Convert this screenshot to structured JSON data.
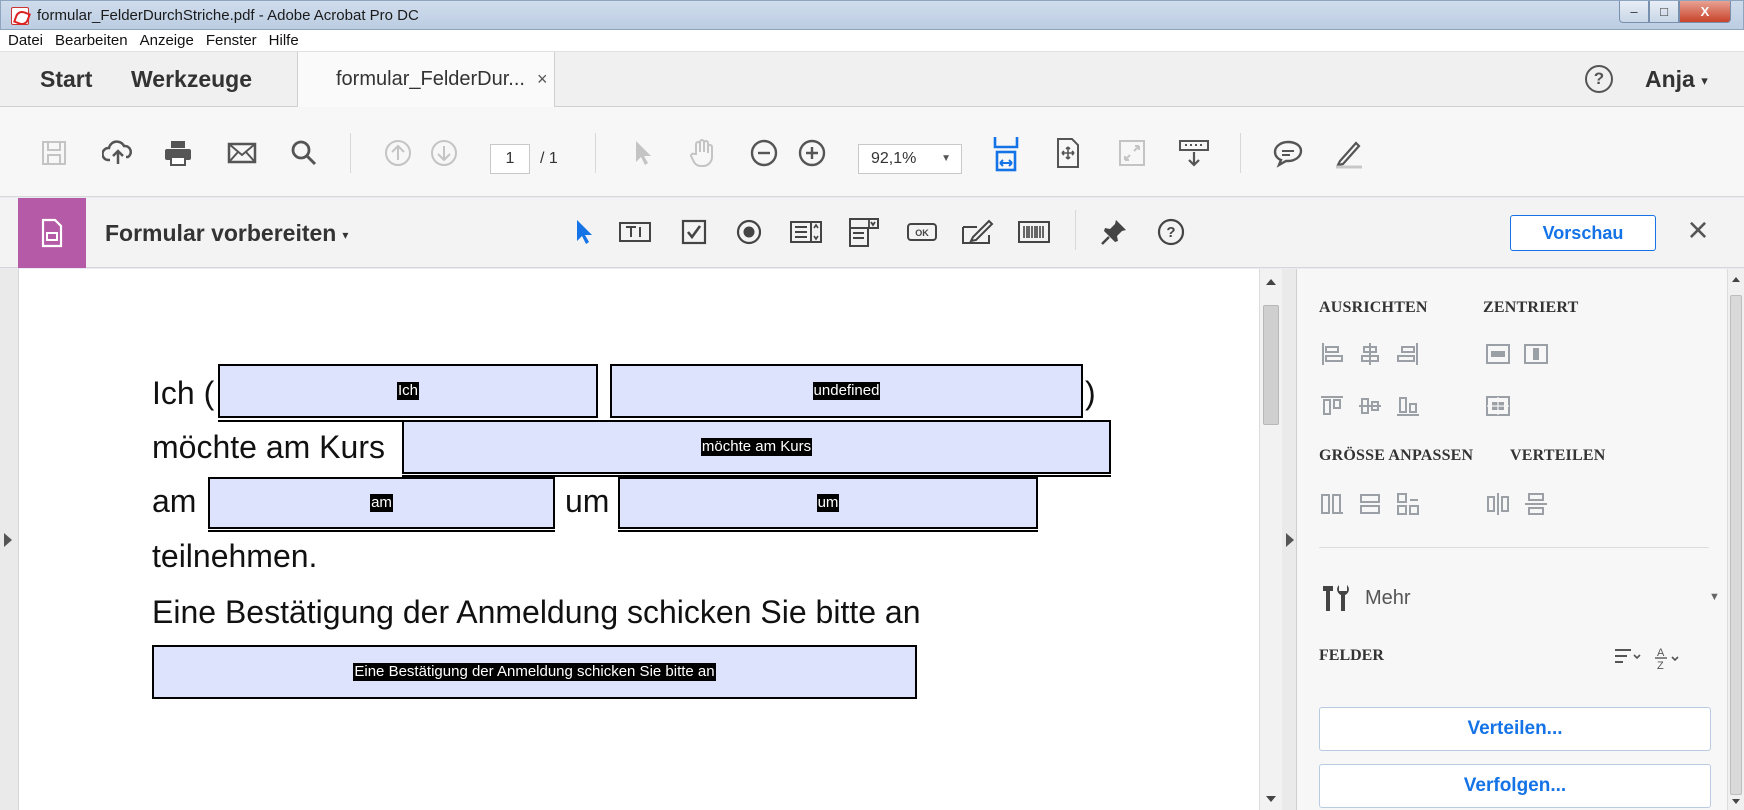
{
  "window": {
    "title": "formular_FelderDurchStriche.pdf - Adobe Acrobat Pro DC",
    "min_glyph": "–",
    "max_glyph": "□",
    "close_glyph": "X"
  },
  "menu": [
    "Datei",
    "Bearbeiten",
    "Anzeige",
    "Fenster",
    "Hilfe"
  ],
  "tabs": {
    "start": "Start",
    "tools": "Werkzeuge",
    "document": "formular_FelderDur...",
    "document_close": "×",
    "help": "?",
    "user": "Anja"
  },
  "toolbar": {
    "page_current": "1",
    "page_total": "/ 1",
    "zoom": "92,1%"
  },
  "form_toolbar": {
    "title": "Formular vorbereiten",
    "preview": "Vorschau",
    "close": "×"
  },
  "document": {
    "lines": {
      "line1_start": "Ich (",
      "line1_end": ")",
      "line2_start": "möchte am Kurs",
      "line3_am": "am",
      "line3_um": "um",
      "line4": "teilnehmen.",
      "line5": "Eine Bestätigung der Anmeldung schicken Sie bitte an"
    },
    "fields": {
      "ich": "Ich",
      "undefined": "undefined",
      "kurs": "möchte am Kurs",
      "am": "am",
      "um": "um",
      "bestaetigung": "Eine Bestätigung der Anmeldung schicken Sie bitte an"
    }
  },
  "right_panel": {
    "align_heading": "AUSRICHTEN",
    "center_heading": "ZENTRIERT",
    "resize_heading": "GRÖSSE ANPASSEN",
    "distribute_heading": "VERTEILEN",
    "more": "Mehr",
    "fields_heading": "FELDER",
    "distribute_button": "Verteilen...",
    "track_button": "Verfolgen..."
  },
  "colors": {
    "accent": "#1473e6",
    "form_tab": "#b55aa6",
    "field_fill": "#dde3fc"
  }
}
